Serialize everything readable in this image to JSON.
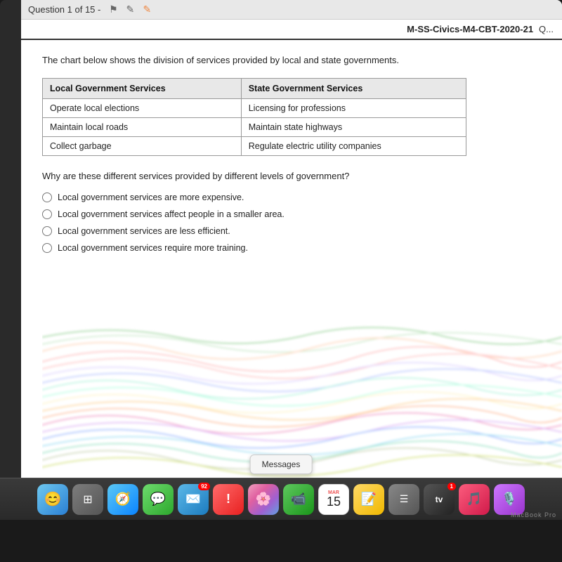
{
  "toolbar": {
    "question_nav": "Question 1 of 15 -",
    "nav_icon1": "⚑",
    "nav_icon2": "✎",
    "nav_icon3": "↺"
  },
  "exam": {
    "code": "M-SS-Civics-M4-CBT-2020-21",
    "description": "The chart below shows the division of services provided by local and state governments.",
    "table": {
      "col1_header": "Local Government Services",
      "col2_header": "State Government Services",
      "rows": [
        {
          "col1": "Operate local elections",
          "col2": "Licensing for professions"
        },
        {
          "col1": "Maintain local roads",
          "col2": "Maintain state highways"
        },
        {
          "col1": "Collect garbage",
          "col2": "Regulate electric utility companies"
        }
      ]
    },
    "question": "Why are these different services provided by different levels of government?",
    "choices": [
      {
        "id": "A",
        "text": "Local government services are more expensive."
      },
      {
        "id": "B",
        "text": "Local government services affect people in a smaller area."
      },
      {
        "id": "C",
        "text": "Local government services are less efficient."
      },
      {
        "id": "D",
        "text": "Local government services require more training."
      }
    ]
  },
  "messages_popup": "Messages",
  "dock": {
    "items": [
      {
        "name": "Finder",
        "icon": "🖥"
      },
      {
        "name": "Launchpad",
        "icon": "⊞"
      },
      {
        "name": "Safari",
        "icon": "🧭"
      },
      {
        "name": "Messages",
        "icon": "💬"
      },
      {
        "name": "Mail",
        "icon": "✉"
      },
      {
        "name": "Reminders",
        "icon": "!"
      },
      {
        "name": "Photos",
        "icon": "🌸"
      },
      {
        "name": "FaceTime",
        "icon": "📹"
      },
      {
        "name": "Calendar",
        "month": "MAR",
        "day": "15"
      },
      {
        "name": "Notes",
        "icon": "📝"
      },
      {
        "name": "Reminders2",
        "icon": "☰"
      },
      {
        "name": "AppleTV",
        "icon": "▶"
      },
      {
        "name": "Music",
        "icon": "♪"
      },
      {
        "name": "Podcasts",
        "icon": "🎙"
      }
    ]
  },
  "macbook_label": "MacBook Pro"
}
